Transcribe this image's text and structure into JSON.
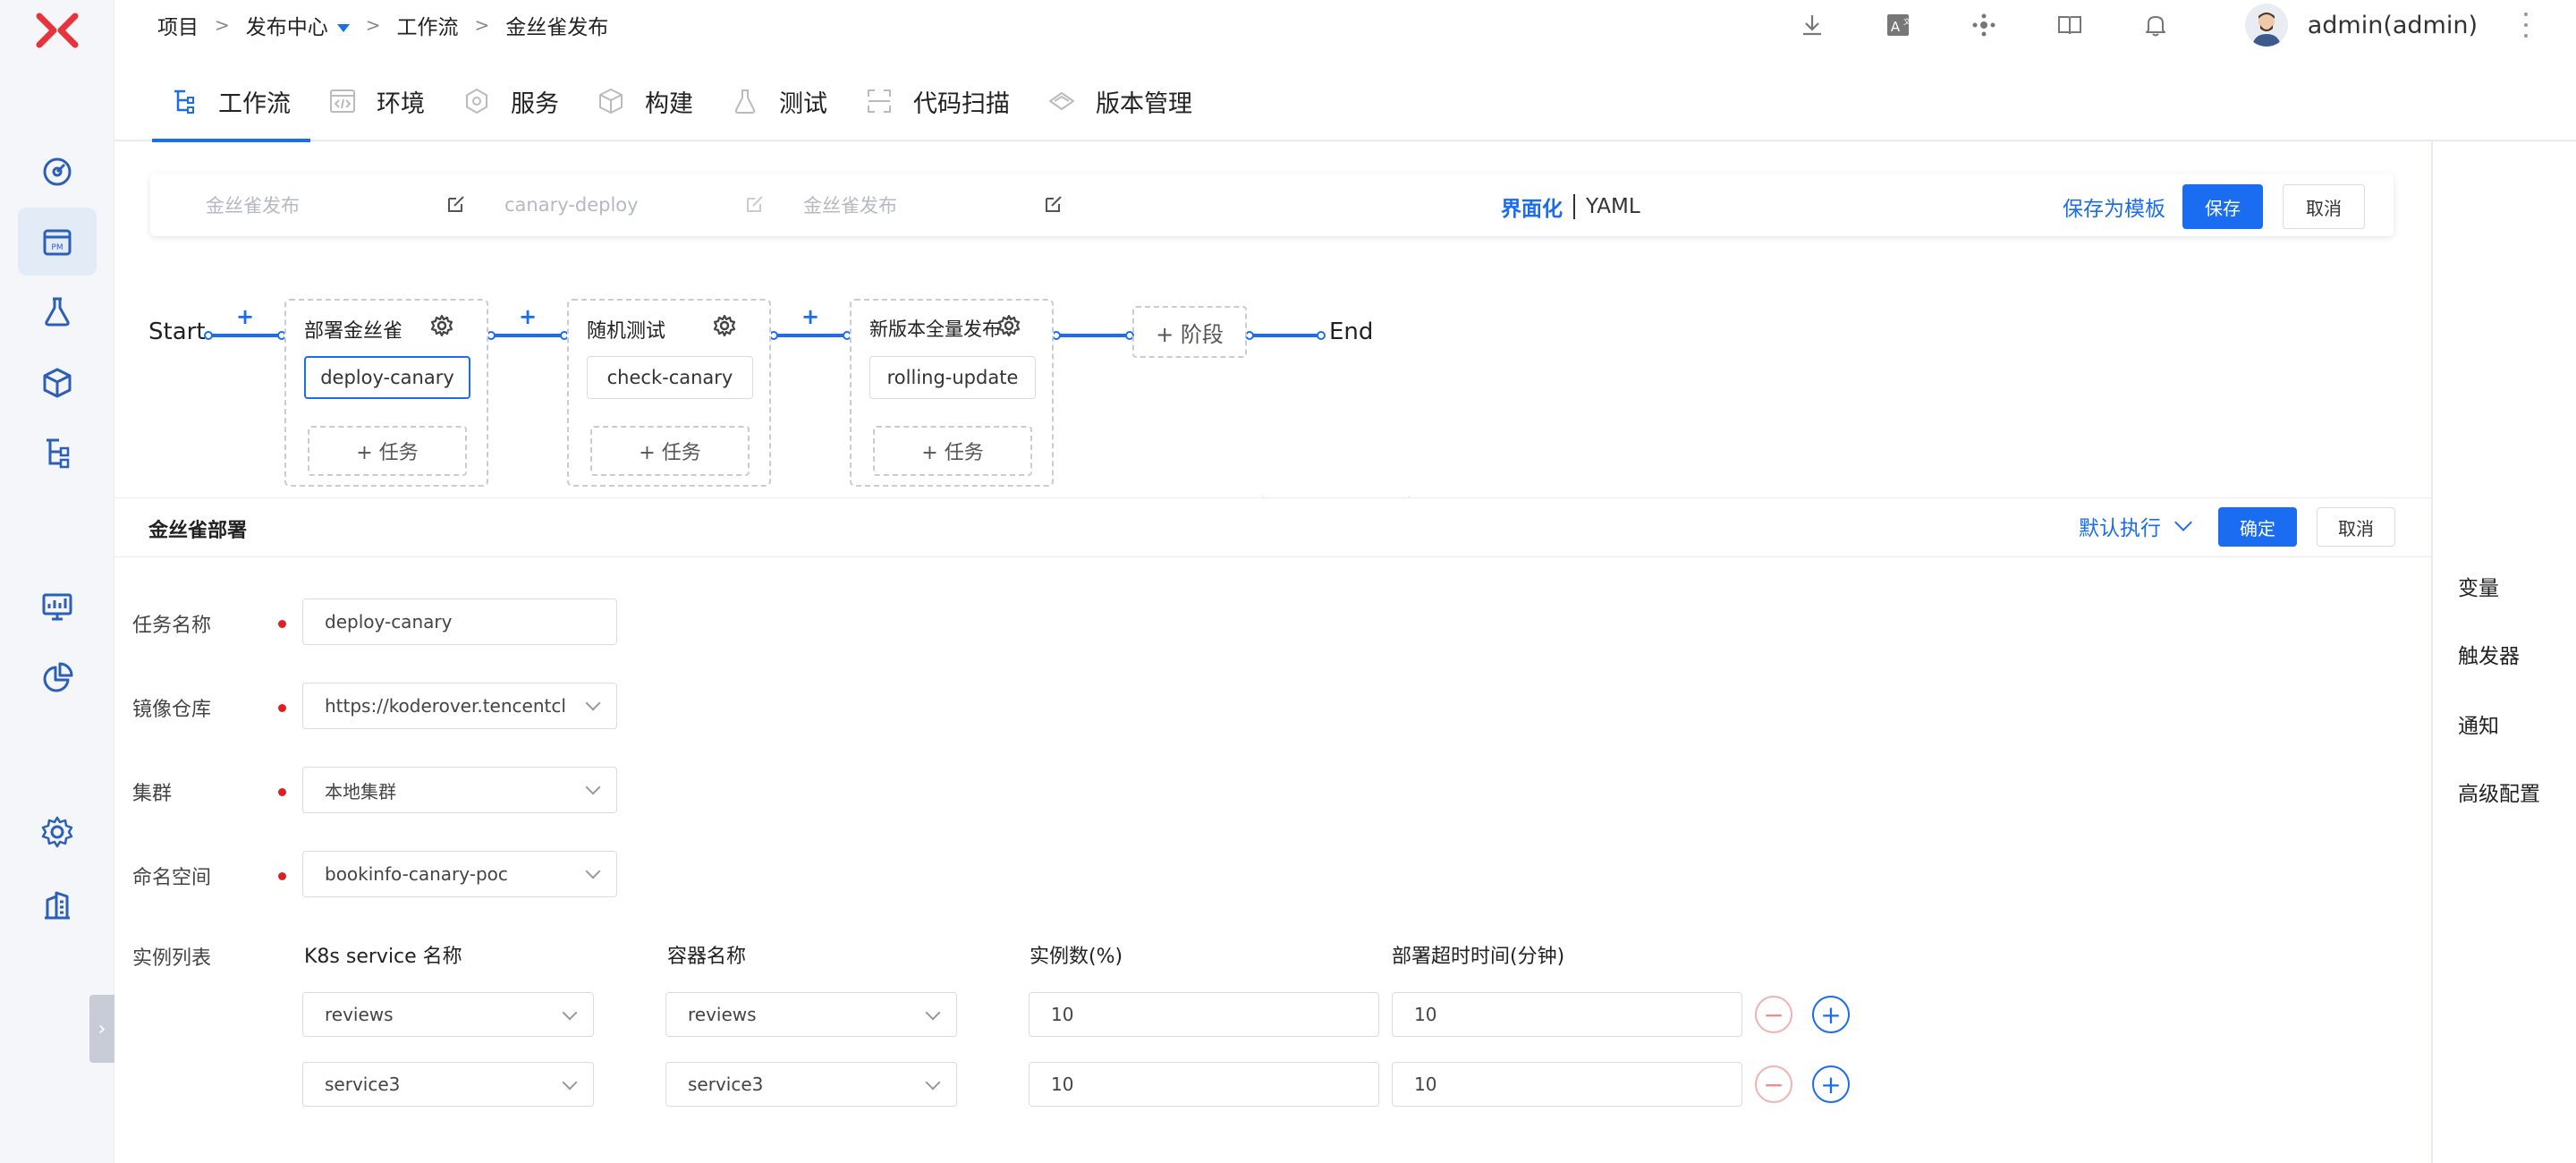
{
  "breadcrumb": {
    "items": [
      "项目",
      "发布中心",
      "工作流",
      "金丝雀发布"
    ],
    "separator": ">"
  },
  "user": {
    "name": "admin(admin)"
  },
  "tabs": [
    {
      "label": "工作流",
      "icon": "workflow-icon"
    },
    {
      "label": "环境",
      "icon": "environment-icon"
    },
    {
      "label": "服务",
      "icon": "service-icon"
    },
    {
      "label": "构建",
      "icon": "build-icon"
    },
    {
      "label": "测试",
      "icon": "test-icon"
    },
    {
      "label": "代码扫描",
      "icon": "scan-icon"
    },
    {
      "label": "版本管理",
      "icon": "version-icon"
    }
  ],
  "header": {
    "display_name": "金丝雀发布",
    "workflow_key": "canary-deploy",
    "description": "金丝雀发布",
    "mode_ui": "界面化",
    "mode_yaml": "YAML",
    "save_template": "保存为模板",
    "save": "保存",
    "cancel": "取消"
  },
  "pipeline": {
    "start": "Start",
    "end": "End",
    "plus": "+",
    "add_stage": "+ 阶段",
    "stages": [
      {
        "title": "部署金丝雀",
        "job": "deploy-canary",
        "add_task": "+ 任务"
      },
      {
        "title": "随机测试",
        "job": "check-canary",
        "add_task": "+ 任务"
      },
      {
        "title": "新版本全量发布",
        "job": "rolling-update",
        "add_task": "+ 任务"
      }
    ]
  },
  "panel": {
    "title": "金丝雀部署",
    "exec_mode": "默认执行",
    "confirm": "确定",
    "cancel": "取消",
    "fields": [
      {
        "label": "任务名称",
        "value": "deploy-canary"
      },
      {
        "label": "镜像仓库",
        "value": "https://koderover.tencentcloudcr.com"
      },
      {
        "label": "集群",
        "value": "本地集群"
      },
      {
        "label": "命名空间",
        "value": "bookinfo-canary-poc"
      }
    ],
    "instance_label": "实例列表",
    "columns": [
      "K8s service 名称",
      "容器名称",
      "实例数(%)",
      "部署超时时间(分钟)"
    ],
    "rows": [
      {
        "service": "reviews",
        "container": "reviews",
        "percent": "10",
        "timeout": "10"
      },
      {
        "service": "service3",
        "container": "service3",
        "percent": "10",
        "timeout": "10"
      }
    ]
  },
  "right_menu": [
    "变量",
    "触发器",
    "通知",
    "高级配置"
  ],
  "colors": {
    "primary": "#1a6cf0",
    "logo": "#e8333b",
    "danger": "#e02020"
  }
}
